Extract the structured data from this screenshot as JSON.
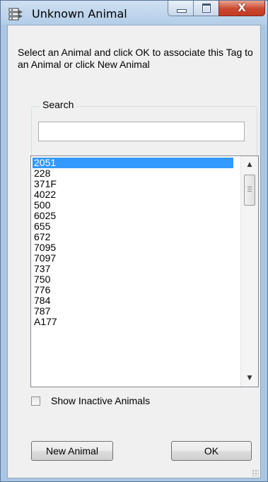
{
  "window": {
    "title": "Unknown Animal",
    "icon": "tag-app-icon",
    "caption_buttons": [
      "minimize-icon",
      "maximize-icon",
      "close-icon"
    ],
    "close_glyph": "X"
  },
  "dialog": {
    "instructions": "Select an Animal and click OK to associate this Tag to an Animal or click New Animal",
    "search": {
      "group_label": "Search",
      "value": ""
    },
    "animals": [
      "2051",
      "228",
      "371F",
      "4022",
      "500",
      "6025",
      "655",
      "672",
      "7095",
      "7097",
      "737",
      "750",
      "776",
      "784",
      "787",
      "A177"
    ],
    "selected_animal": "2051",
    "show_inactive": {
      "label": "Show Inactive Animals",
      "checked": false
    },
    "buttons": {
      "new_animal": "New Animal",
      "ok": "OK"
    }
  },
  "colors": {
    "selection": "#3399ff",
    "close_button": "#c43a22",
    "frame": "#a9c6e3"
  }
}
